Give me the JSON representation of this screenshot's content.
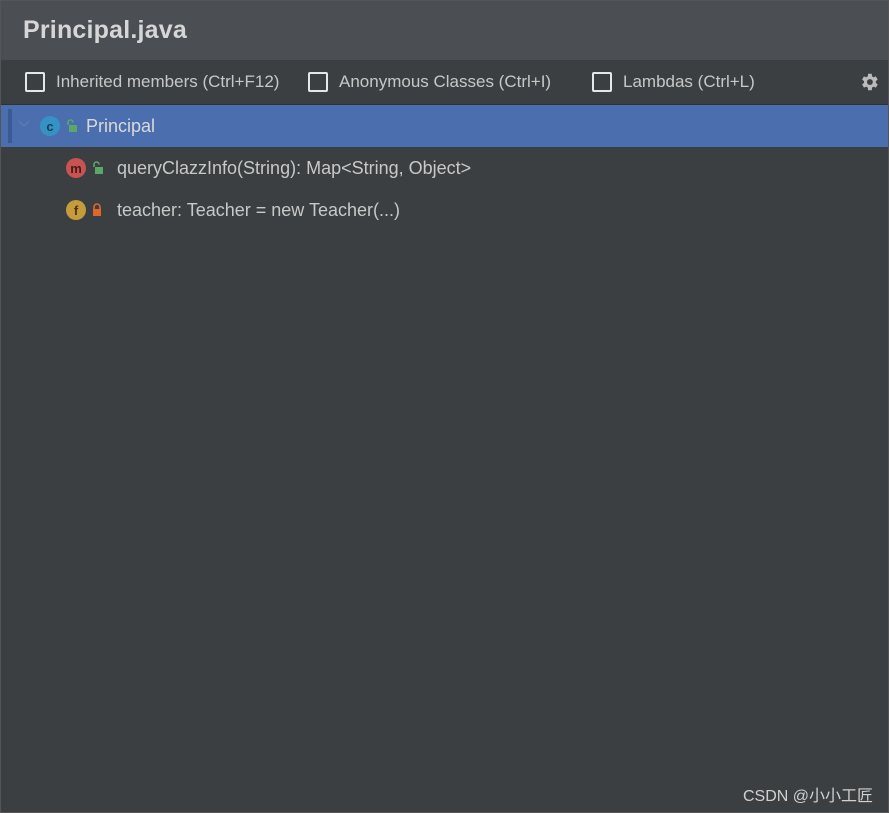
{
  "window": {
    "title": "Principal.java"
  },
  "toolbar": {
    "options": [
      {
        "label": "Inherited members (Ctrl+F12)",
        "checked": false
      },
      {
        "label": "Anonymous Classes (Ctrl+I)",
        "checked": false
      },
      {
        "label": "Lambdas (Ctrl+L)",
        "checked": false
      }
    ],
    "settings_icon": "gear-icon"
  },
  "tree": {
    "root": {
      "label": "Principal",
      "kind": "c",
      "access": "public",
      "expanded": true,
      "selected": true
    },
    "children": [
      {
        "label": "queryClazzInfo(String): Map<String, Object>",
        "kind": "m",
        "access": "public"
      },
      {
        "label": "teacher: Teacher = new Teacher(...)",
        "kind": "f",
        "access": "private"
      }
    ]
  },
  "watermark": "CSDN @小小工匠",
  "colors": {
    "selection": "#4b6eaf",
    "class_badge": "#3592c4",
    "method_badge": "#c75450",
    "field_badge": "#c59c3b",
    "public_lock": "#59a869",
    "private_lock": "#e0662c"
  }
}
